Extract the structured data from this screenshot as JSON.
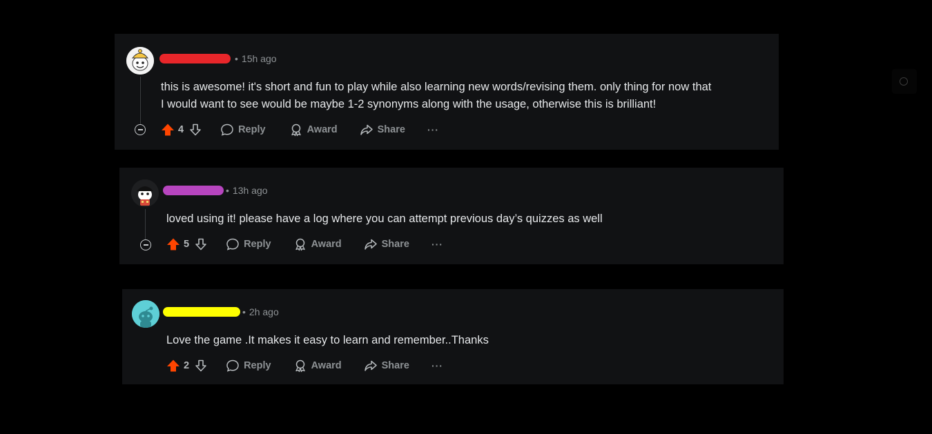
{
  "colors": {
    "upvote_active": "#ff4500",
    "card_bg": "#111214",
    "redact_1": "#e8262a",
    "redact_2": "#b745bf",
    "redact_3": "#ffff00"
  },
  "comments": [
    {
      "avatar_icon": "snoo-avatar-yellow-hat",
      "time": "15h ago",
      "body_lines": [
        "this is awesome! it's short and fun to play while also learning new words/revising them. only thing for now that",
        "I would want to see would be maybe 1-2 synonyms along with the usage, otherwise this is brilliant!"
      ],
      "score": "4",
      "reply_label": "Reply",
      "award_label": "Award",
      "share_label": "Share",
      "more_label": "···"
    },
    {
      "avatar_icon": "snoo-avatar-dark-hat",
      "time": "13h ago",
      "body_lines": [
        "loved using it! please have a log where you can attempt previous day’s quizzes as well"
      ],
      "score": "5",
      "reply_label": "Reply",
      "award_label": "Award",
      "share_label": "Share",
      "more_label": "···"
    },
    {
      "avatar_icon": "snoo-default-avatar-teal",
      "time": "2h ago",
      "body_lines": [
        "Love the game .It makes it easy to learn and remember..Thanks"
      ],
      "score": "2",
      "reply_label": "Reply",
      "award_label": "Award",
      "share_label": "Share",
      "more_label": "···"
    }
  ]
}
